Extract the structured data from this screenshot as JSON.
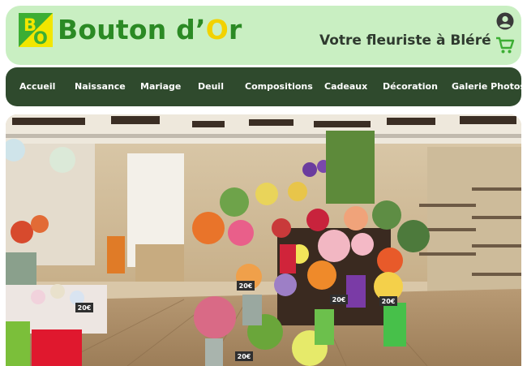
{
  "header": {
    "logo_badge_text": "BO",
    "logo_prefix": "Bouton d’",
    "logo_highlight": "O",
    "logo_suffix": "r",
    "tagline": "Votre fleuriste à Bléré"
  },
  "nav": {
    "items": [
      {
        "label": "Accueil"
      },
      {
        "label": "Naissance"
      },
      {
        "label": "Mariage"
      },
      {
        "label": "Deuil"
      },
      {
        "label": "Compositions"
      },
      {
        "label": "Cadeaux"
      },
      {
        "label": "Décoration"
      },
      {
        "label": "Galerie Photos"
      }
    ]
  },
  "icons": {
    "account": "account-circle-icon",
    "cart": "cart-icon"
  },
  "colors": {
    "header_bg": "#c9efc2",
    "brand_green": "#2b8a24",
    "brand_yellow": "#f2e600",
    "nav_bg": "#2f4a2d"
  },
  "photo": {
    "tags": [
      "20€",
      "20€",
      "20€",
      "20€",
      "20€"
    ]
  }
}
